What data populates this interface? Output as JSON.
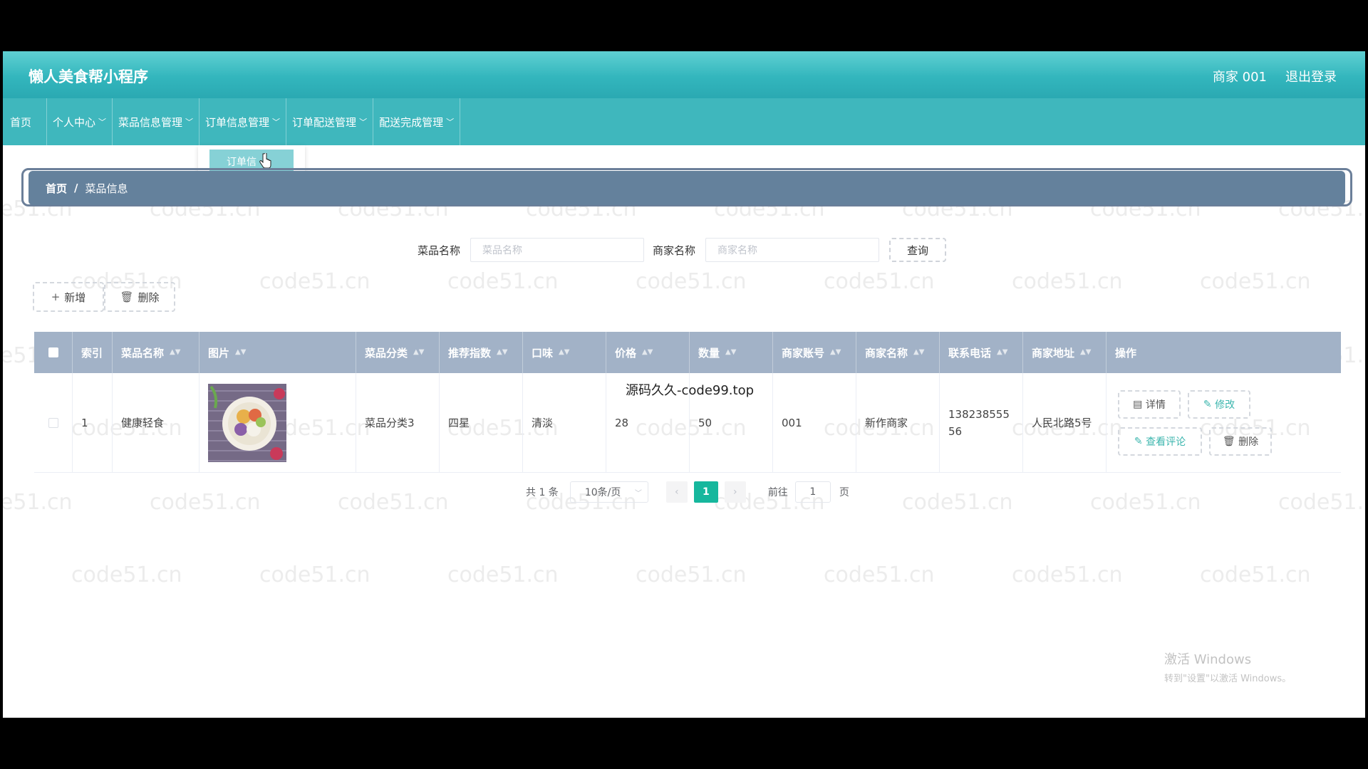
{
  "header": {
    "app_title": "懒人美食帮小程序",
    "user_label": "商家 001",
    "logout_label": "退出登录"
  },
  "nav": {
    "items": [
      {
        "label": "首页",
        "dropdown": false
      },
      {
        "label": "个人中心",
        "dropdown": true
      },
      {
        "label": "菜品信息管理",
        "dropdown": true
      },
      {
        "label": "订单信息管理",
        "dropdown": true
      },
      {
        "label": "订单配送管理",
        "dropdown": true
      },
      {
        "label": "配送完成管理",
        "dropdown": true
      }
    ],
    "open_dropdown_item": "订单信"
  },
  "breadcrumb": {
    "home": "首页",
    "separator": "/",
    "current": "菜品信息"
  },
  "search": {
    "dish_label": "菜品名称",
    "dish_placeholder": "菜品名称",
    "merchant_label": "商家名称",
    "merchant_placeholder": "商家名称",
    "query_button": "查询"
  },
  "toolbar": {
    "add_label": "新增",
    "delete_label": "删除"
  },
  "table": {
    "columns": [
      "索引",
      "菜品名称",
      "图片",
      "菜品分类",
      "推荐指数",
      "口味",
      "价格",
      "数量",
      "商家账号",
      "商家名称",
      "联系电话",
      "商家地址",
      "操作"
    ],
    "rows": [
      {
        "index": "1",
        "name": "健康轻食",
        "category": "菜品分类3",
        "rating": "四星",
        "flavor": "清淡",
        "price": "28",
        "quantity": "50",
        "merchant_account": "001",
        "merchant_name": "新作商家",
        "phone": "13823855556",
        "address": "人民北路5号"
      }
    ],
    "row_actions": {
      "detail": "详情",
      "edit": "修改",
      "review": "查看评论",
      "delete": "删除"
    }
  },
  "overlay_text": "源码久久-code99.top",
  "pagination": {
    "total": "共 1 条",
    "page_size": "10条/页",
    "current_page": "1",
    "goto_label": "前往",
    "goto_value": "1",
    "page_suffix": "页"
  },
  "watermark": "code51.cn",
  "windows_activation": {
    "title": "激活 Windows",
    "subtitle": "转到\"设置\"以激活 Windows。"
  },
  "colors": {
    "header": "#33b6bd",
    "nav": "#3fb7bd",
    "breadcrumb": "#64819c",
    "table_header": "#a2b2c7",
    "accent": "#16b79d"
  }
}
